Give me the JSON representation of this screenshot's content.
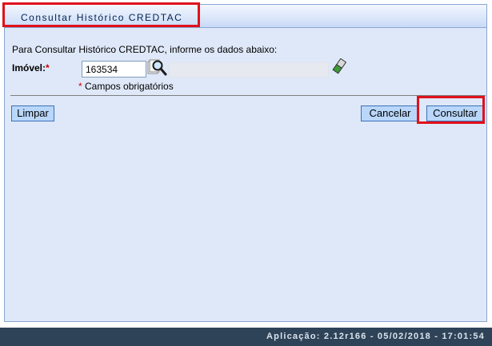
{
  "page": {
    "title": "Consultar Histórico CREDTAC"
  },
  "form": {
    "intro": "Para Consultar Histórico CREDTAC, informe os dados abaixo:",
    "imovel": {
      "label": "Imóvel:",
      "required_mark": "*",
      "value": "163534",
      "description_value": ""
    },
    "required_note": {
      "star": "*",
      "text": " Campos obrigatórios"
    }
  },
  "buttons": {
    "clear": "Limpar",
    "cancel": "Cancelar",
    "submit": "Consultar"
  },
  "footer": {
    "text": "Aplicação: 2.12r166 - 05/02/2018 - 17:01:54"
  },
  "colors": {
    "highlight": "#e0111b",
    "panel_bg": "#dfe8f8",
    "button_bg": "#b9d7fa",
    "footer_bg": "#2e4358"
  },
  "icons": {
    "search": "magnifier-search-icon",
    "clear_field": "eraser-icon"
  }
}
